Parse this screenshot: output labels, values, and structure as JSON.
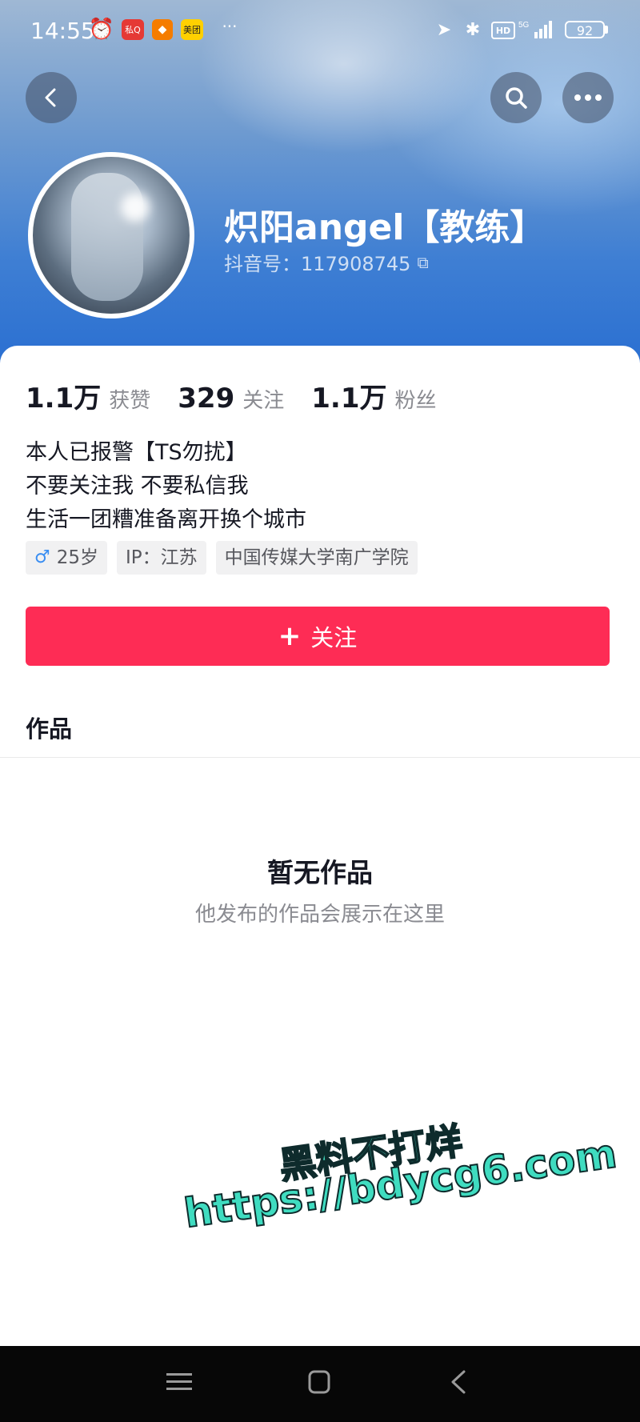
{
  "status_bar": {
    "time": "14:55",
    "app_icons": [
      "alarm-icon",
      "app-icon-1",
      "app-icon-2",
      "app-icon-3"
    ],
    "app_icon_labels": [
      "私Q",
      "",
      "美团"
    ],
    "network": "5G",
    "hd_label": "HD",
    "battery": "92"
  },
  "header": {
    "back_icon": "back-arrow-icon",
    "search_icon": "search-icon",
    "more_icon": "more-icon"
  },
  "profile": {
    "username": "炽阳angel【教练】",
    "douyin_id_label": "抖音号：117908745",
    "stats": [
      {
        "value": "1.1万",
        "label": "获赞"
      },
      {
        "value": "329",
        "label": "关注"
      },
      {
        "value": "1.1万",
        "label": "粉丝"
      }
    ],
    "bio": [
      "本人已报警【TS勿扰】",
      "不要关注我 不要私信我",
      "生活一团糟准备离开换个城市"
    ],
    "tags": [
      {
        "icon": "male-icon",
        "text": "25岁"
      },
      {
        "text": "IP：江苏"
      },
      {
        "text": "中国传媒大学南广学院"
      }
    ],
    "follow_button": "关注"
  },
  "works": {
    "section_title": "作品",
    "empty_title": "暂无作品",
    "empty_subtitle": "他发布的作品会展示在这里"
  },
  "watermark": {
    "line1": "黑料不打烊",
    "line2": "https://bdycg6.com"
  },
  "colors": {
    "accent": "#fe2c55",
    "hero_gradient_top": "#9fb8d4",
    "hero_gradient_bottom": "#2a6fd2",
    "watermark": "#3fdcc0"
  }
}
